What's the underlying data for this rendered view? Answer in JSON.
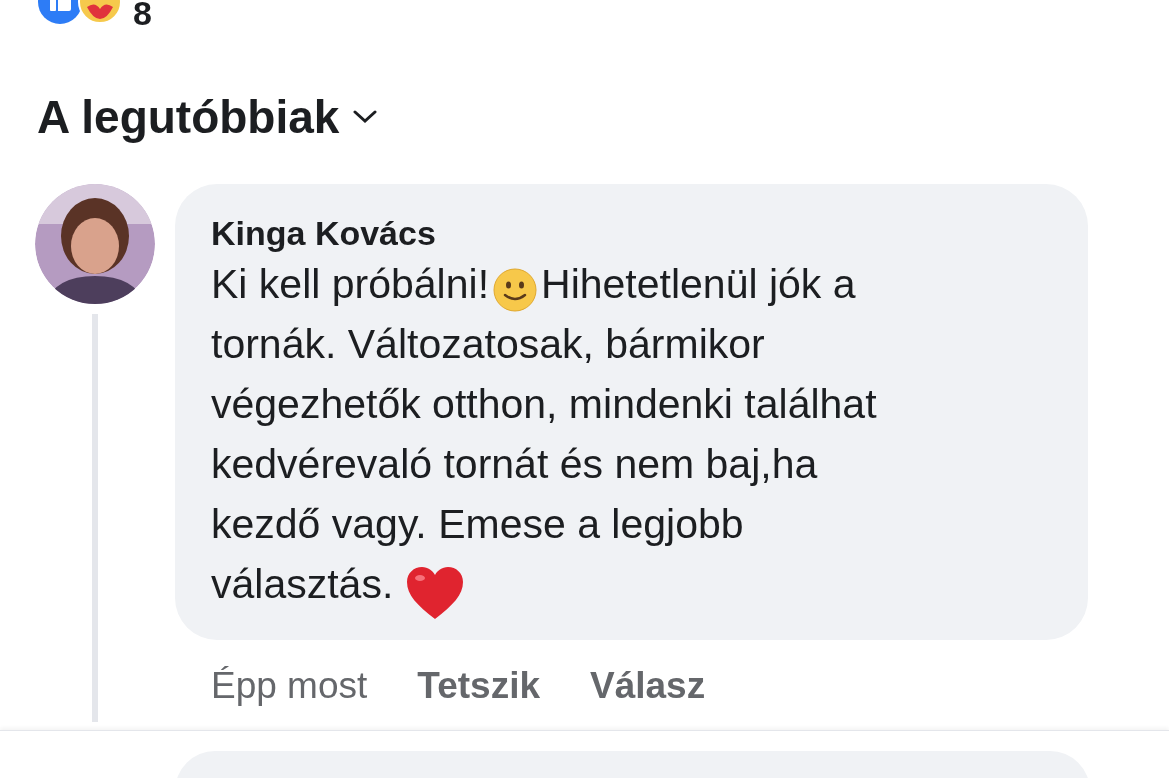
{
  "reactions": {
    "count": "8"
  },
  "sort": {
    "label": "A legutóbbiak"
  },
  "comment": {
    "author": "Kinga Kovács",
    "lines": [
      [
        {
          "kind": "text",
          "text": "Ki kell próbálni!"
        },
        {
          "kind": "smile"
        },
        {
          "kind": "text",
          "text": "Hihetetlenül jók a"
        }
      ],
      [
        {
          "kind": "text",
          "text": "tornák. Változatosak, bármikor"
        }
      ],
      [
        {
          "kind": "text",
          "text": "végezhetők otthon, mindenki találhat"
        }
      ],
      [
        {
          "kind": "text",
          "text": "kedvérevaló tornát és nem baj,ha"
        }
      ],
      [
        {
          "kind": "text",
          "text": "kezdő vagy. Emese a legjobb"
        }
      ],
      [
        {
          "kind": "text",
          "text": "választás. "
        },
        {
          "kind": "heart"
        }
      ]
    ],
    "time": "Épp most",
    "actions": [
      "Tetszik",
      "Válasz"
    ]
  }
}
